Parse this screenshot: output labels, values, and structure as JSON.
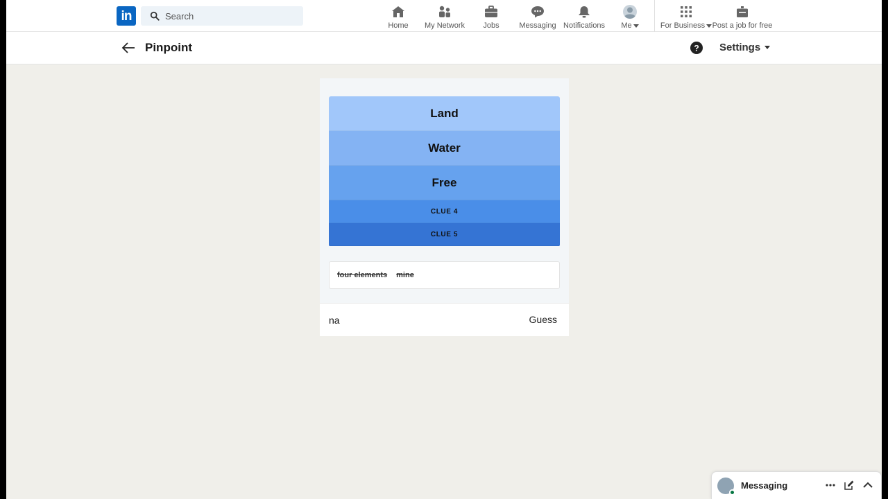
{
  "nav": {
    "logo_text": "in",
    "search_placeholder": "Search",
    "items": [
      {
        "label": "Home",
        "icon": "home-icon"
      },
      {
        "label": "My Network",
        "icon": "network-icon"
      },
      {
        "label": "Jobs",
        "icon": "briefcase-icon"
      },
      {
        "label": "Messaging",
        "icon": "chat-icon"
      },
      {
        "label": "Notifications",
        "icon": "bell-icon"
      },
      {
        "label": "Me",
        "icon": "avatar"
      },
      {
        "label": "For Business",
        "icon": "grid-icon"
      },
      {
        "label": "Post a job for free",
        "icon": "post-job-icon"
      }
    ]
  },
  "subheader": {
    "title": "Pinpoint",
    "settings_label": "Settings"
  },
  "game": {
    "clues": [
      {
        "label": "Land",
        "revealed": true,
        "color": "#a1c7fa"
      },
      {
        "label": "Water",
        "revealed": true,
        "color": "#84b3f3"
      },
      {
        "label": "Free",
        "revealed": true,
        "color": "#66a2ee"
      },
      {
        "label": "CLUE 4",
        "revealed": false,
        "color": "#4a8ee8"
      },
      {
        "label": "CLUE 5",
        "revealed": false,
        "color": "#3574d4"
      }
    ],
    "wrong_guesses": [
      "four elements",
      "mine"
    ],
    "input_value": "na",
    "guess_button": "Guess"
  },
  "messaging": {
    "title": "Messaging"
  },
  "colors": {
    "brand": "#0a66c2",
    "background": "#f0efea"
  }
}
